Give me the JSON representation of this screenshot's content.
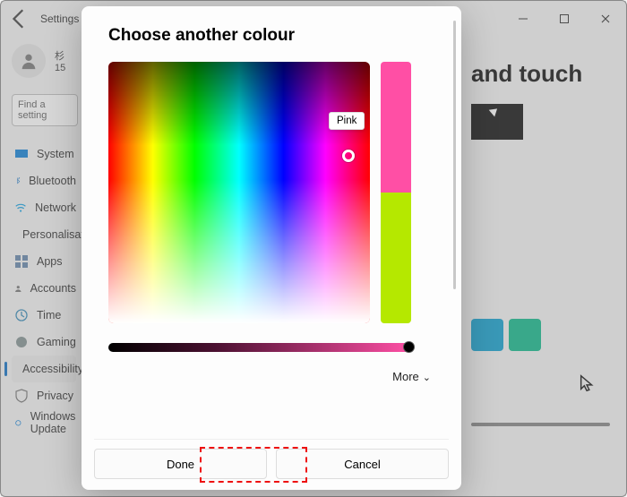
{
  "window": {
    "title": "Settings"
  },
  "user": {
    "name_trunc": "杉",
    "sub": "15"
  },
  "search": {
    "placeholder": "Find a setting"
  },
  "sidebar": {
    "items": [
      {
        "label": "System"
      },
      {
        "label": "Bluetooth"
      },
      {
        "label": "Network"
      },
      {
        "label": "Personalisation"
      },
      {
        "label": "Apps"
      },
      {
        "label": "Accounts"
      },
      {
        "label": "Time"
      },
      {
        "label": "Gaming"
      },
      {
        "label": "Accessibility"
      },
      {
        "label": "Privacy"
      },
      {
        "label": "Windows Update"
      }
    ]
  },
  "page": {
    "heading_fragment": "and touch"
  },
  "dialog": {
    "title": "Choose another colour",
    "tooltip": "Pink",
    "more": "More",
    "done": "Done",
    "cancel": "Cancel",
    "swatch_top": "#ff4fa5",
    "swatch_bottom": "#b5e800"
  }
}
